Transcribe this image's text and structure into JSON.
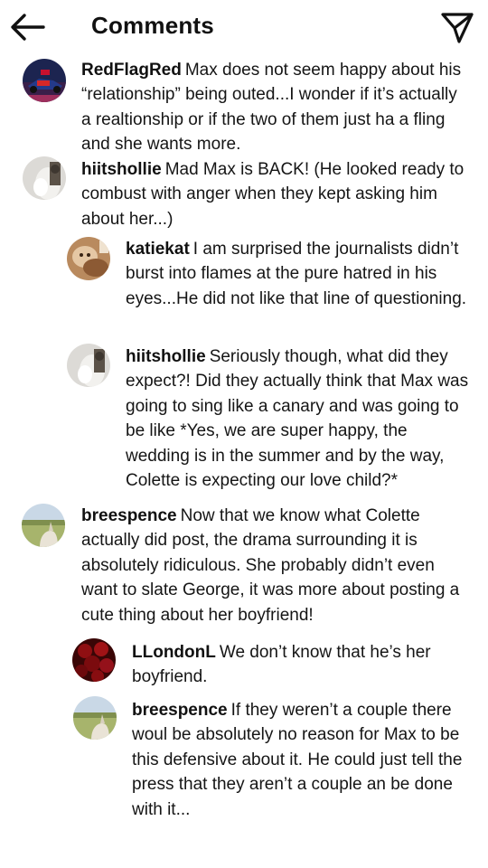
{
  "header": {
    "title": "Comments"
  },
  "icons": {
    "back": "arrow-left-icon",
    "send": "paper-plane-icon"
  },
  "comments": [
    {
      "username": "RedFlagRed",
      "text": "Max does not seem happy about his “relationship” being outed...I wonder if it’s actually a realtionship or if the two of them just ha a fling and she wants more."
    },
    {
      "username": "hiitshollie",
      "text": "Mad Max is BACK! (He looked ready to combust with anger when they kept asking him about her...)"
    },
    {
      "username": "katiekat",
      "text": "I am surprised the journalists didn’t burst into flames at the pure hatred in his eyes...He did not like that line of questioning."
    },
    {
      "username": "hiitshollie",
      "text": "Seriously though, what did they expect?! Did they actually think that Max was going to sing like a canary and was going to be like *Yes, we are super happy, the wedding is in the summer and by the way, Colette is expecting our love child?*"
    },
    {
      "username": "breespence",
      "text": "Now that we know what Colette actually did post, the drama surrounding it is absolutely ridiculous. She probably didn’t even want to slate George, it was more about posting a cute thing about her boyfriend!"
    },
    {
      "username": "LLondonL",
      "text": "We don’t know that he’s her boyfriend."
    },
    {
      "username": "breespence",
      "text": "If they weren’t a couple there woul be absolutely no reason for Max to be this defensive about it. He could just tell the press that they aren’t a couple an be done with it..."
    }
  ]
}
